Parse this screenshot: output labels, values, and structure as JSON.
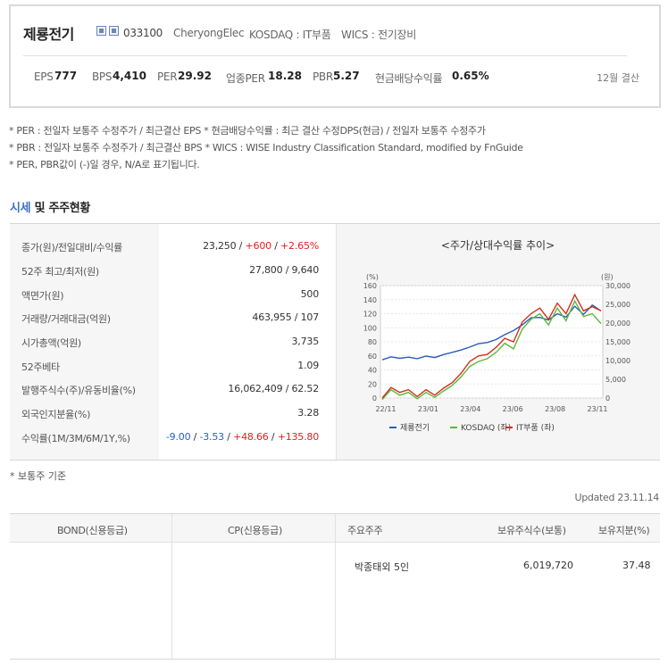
{
  "header": {
    "company_name": "제룡전기",
    "code": "033100",
    "english_name": "CheryongElec",
    "market": "KOSDAQ : IT부품",
    "wics": "WICS : 전기장비",
    "metrics": [
      {
        "label": "EPS",
        "value": "777"
      },
      {
        "label": "BPS",
        "value": "4,410"
      },
      {
        "label": "PER",
        "value": "29.92"
      },
      {
        "label": "업종PER",
        "value": "18.28"
      },
      {
        "label": "PBR",
        "value": "5.27"
      },
      {
        "label": "현금배당수익률",
        "value": "0.65%"
      }
    ],
    "fiscal": "12월 결산"
  },
  "notes": [
    "* PER : 전일자 보통주 수정주가 / 최근결산 EPS * 현금배당수익률 : 최근 결산 수정DPS(현금) / 전일자 보통주 수정주가",
    "* PBR : 전일자 보통주 수정주가 / 최근결산 BPS * WICS : WISE Industry Classification Standard, modified by FnGuide",
    "* PER, PBR값이 (-)일 경우, N/A로 표기됩니다."
  ],
  "section": {
    "title_a": "시세",
    "title_b": "및 주주현황"
  },
  "quote": {
    "rows": [
      {
        "label": "종가(원)/전일대비/수익률",
        "value": "23,250"
      },
      {
        "label": "52주 최고/최저(원)",
        "value": "27,800 / 9,640"
      },
      {
        "label": "액면가(원)",
        "value": "500"
      },
      {
        "label": "거래량/거래대금(억원)",
        "value": "463,955 / 107"
      },
      {
        "label": "시가총액(억원)",
        "value": "3,735"
      },
      {
        "label": "52주베타",
        "value": "1.09"
      },
      {
        "label": "발행주식수(주)/유동비율(%)",
        "value": "16,062,409 / 62.52"
      },
      {
        "label": "외국인지분율(%)",
        "value": "3.28"
      },
      {
        "label": "수익률(1M/3M/6M/1Y,%)",
        "value": ""
      }
    ],
    "price_change": "+600",
    "price_change_pct": "+2.65%",
    "returns": [
      "-9.00",
      "-3.53",
      "+48.66",
      "+135.80"
    ]
  },
  "chart_title": "<주가/상대수익률 추이>",
  "chart_data": {
    "type": "line",
    "x_labels": [
      "22/11",
      "23/01",
      "23/04",
      "23/06",
      "23/08",
      "23/11"
    ],
    "left_axis": {
      "unit": "(%)",
      "ticks": [
        0,
        20,
        40,
        60,
        80,
        100,
        120,
        140,
        160
      ]
    },
    "right_axis": {
      "unit": "(원)",
      "ticks": [
        "0",
        "5,000",
        "10,000",
        "15,000",
        "20,000",
        "25,000",
        "30,000"
      ]
    },
    "series": [
      {
        "name": "제룡전기",
        "color": "#2c5db8",
        "axis": "right",
        "values": [
          10200,
          11000,
          10600,
          10900,
          10500,
          11200,
          10800,
          11600,
          12200,
          12800,
          13600,
          14500,
          14800,
          15600,
          16900,
          18000,
          19500,
          21400,
          21500,
          20800,
          22500,
          21600,
          24500,
          22300,
          24800,
          23250
        ]
      },
      {
        "name": "KOSDAQ (좌)",
        "color": "#5bb83a",
        "axis": "left",
        "values": [
          -2,
          12,
          4,
          8,
          -1,
          8,
          1,
          10,
          18,
          30,
          45,
          52,
          56,
          65,
          78,
          70,
          98,
          112,
          120,
          104,
          128,
          110,
          138,
          116,
          120,
          106
        ]
      },
      {
        "name": "IT부품 (좌)",
        "color": "#d0301e",
        "axis": "left",
        "values": [
          0,
          15,
          8,
          12,
          2,
          12,
          4,
          14,
          22,
          35,
          52,
          60,
          62,
          72,
          85,
          80,
          108,
          120,
          128,
          112,
          135,
          120,
          147,
          124,
          130,
          124
        ]
      }
    ]
  },
  "footnote": "* 보통주 기준",
  "updated": "Updated 23.11.14",
  "bottom": {
    "headers": [
      "BOND(신용등급)",
      "CP(신용등급)",
      "주요주주",
      "보유주식수(보통)",
      "보유지분(%)"
    ],
    "holder": {
      "name": "박종태외 5인",
      "shares": "6,019,720",
      "pct": "37.48"
    }
  }
}
